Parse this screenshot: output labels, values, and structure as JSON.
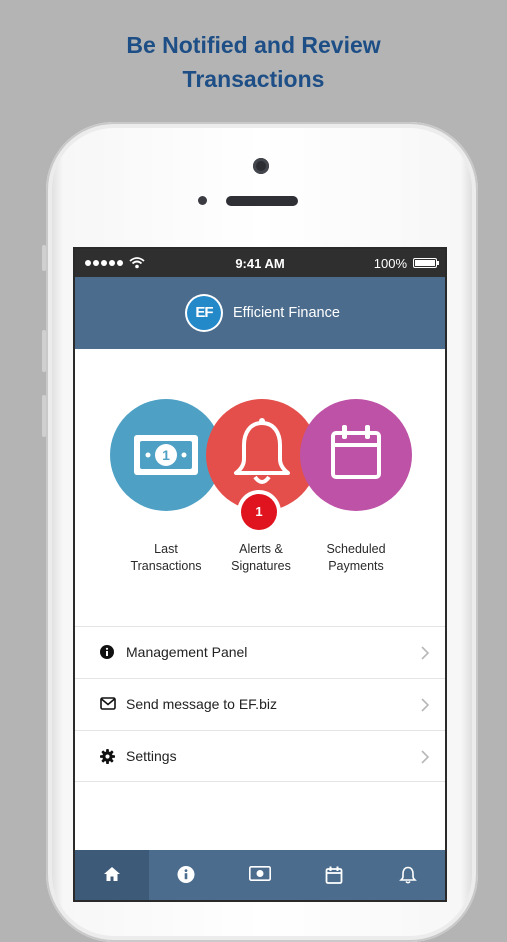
{
  "headline": {
    "line1": "Be Notified and Review",
    "line2": "Transactions"
  },
  "status_bar": {
    "signal_icon": "signal-dots-icon",
    "wifi_icon": "wifi-icon",
    "time": "9:41 AM",
    "battery_text": "100%",
    "battery_icon": "battery-icon"
  },
  "app_bar": {
    "logo_text": "EF",
    "title": "Efficient Finance"
  },
  "shortcuts": [
    {
      "line1": "Last",
      "line2": "Transactions",
      "icon": "banknote-icon",
      "color": "#4ea1c5"
    },
    {
      "line1": "Alerts &",
      "line2": "Signatures",
      "icon": "bell-icon",
      "color": "#e44f4b",
      "badge": "1"
    },
    {
      "line1": "Scheduled",
      "line2": "Payments",
      "icon": "calendar-icon",
      "color": "#bd52a6"
    }
  ],
  "menu": [
    {
      "label": "Management Panel",
      "icon": "info-icon"
    },
    {
      "label": "Send message to EF.biz",
      "icon": "envelope-icon"
    },
    {
      "label": "Settings",
      "icon": "gear-icon"
    }
  ],
  "tab_bar": {
    "tabs": [
      {
        "icon": "home-icon",
        "active": true
      },
      {
        "icon": "info-icon",
        "active": false
      },
      {
        "icon": "banknote-icon",
        "active": false
      },
      {
        "icon": "calendar-icon",
        "active": false
      },
      {
        "icon": "bell-icon",
        "active": false
      }
    ]
  },
  "colors": {
    "headline": "#1d4e86",
    "app_bar": "#4b6c8d",
    "badge": "#e0141f"
  }
}
